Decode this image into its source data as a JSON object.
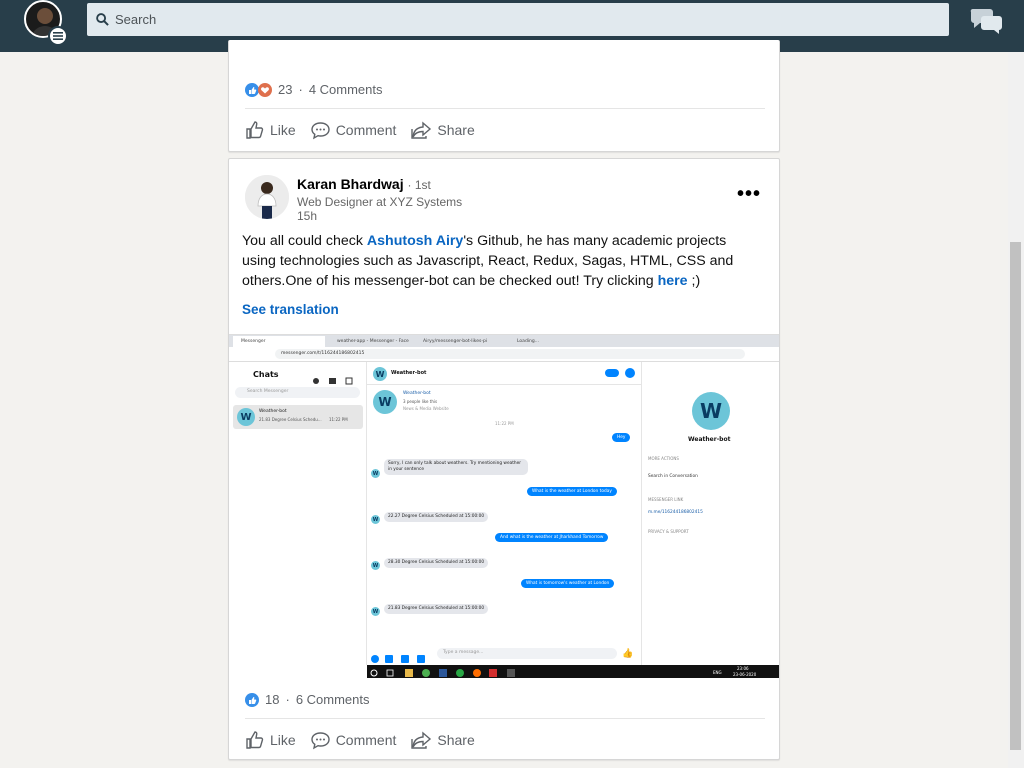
{
  "topbar": {
    "search_placeholder": "Search",
    "colors": {
      "bar": "#283e4a",
      "search_bg": "#e1e9ee"
    },
    "icons": [
      "profile-avatar",
      "menu-icon",
      "search-icon",
      "messaging-icon"
    ]
  },
  "post1": {
    "reactions_count": "23",
    "comments": "4 Comments",
    "reaction_icons": [
      "like-icon",
      "love-icon"
    ],
    "actions": {
      "like": "Like",
      "comment": "Comment",
      "share": "Share"
    }
  },
  "post2": {
    "author": {
      "name": "Karan Bhardwaj",
      "degree": "1st",
      "headline": "Web Designer at XYZ Systems",
      "time": "15h"
    },
    "text": {
      "p1": "You all could check ",
      "link_name": "Ashutosh Airy",
      "p2": "'s Github, he has many academic projects using technologies such as Javascript, React, Redux, Sagas, HTML, CSS and others.One of his messenger-bot can be checked out! Try clicking ",
      "link_here": "here",
      "p3": " ;)"
    },
    "see_translation": "See translation",
    "reactions_count": "18",
    "comments": "6 Comments",
    "actions": {
      "like": "Like",
      "comment": "Comment",
      "share": "Share"
    },
    "link_color": "#0a66c2"
  },
  "screenshot": {
    "tabs": [
      "Messenger",
      "weather-app - Messenger - Face",
      "Airyy/messenger-bot-likes-pi",
      "Loading..."
    ],
    "url": "messenger.com/t/116244186802415",
    "chats_title": "Chats",
    "search_messenger": "Search Messenger",
    "chat_item": {
      "name": "Weather-bot",
      "preview": "21.83 Degree Celsius Schedu...",
      "time": "11:22 PM"
    },
    "header_name": "Weather-bot",
    "intro": {
      "name": "Weather-bot",
      "line1": "3 people like this",
      "line2": "News & Media Website"
    },
    "time_divider": "11:22 PM",
    "messages": [
      {
        "side": "right",
        "text": "Hey"
      },
      {
        "side": "left",
        "text": "Sorry, I can only talk about weathers. Try mentioning weather in your sentence"
      },
      {
        "side": "right",
        "text": "What is the weather at London today"
      },
      {
        "side": "left",
        "text": "22.27 Degree Celsius Scheduled at 15:00:00"
      },
      {
        "side": "right",
        "text": "And what is the weather at Jharkhand Tomorrow"
      },
      {
        "side": "left",
        "text": "28.30 Degree Celsius Scheduled at 15:00:00"
      },
      {
        "side": "right",
        "text": "What is tomorrow's weather at London"
      },
      {
        "side": "left",
        "text": "21.83 Degree Celsius Scheduled at 15:00:00"
      }
    ],
    "composer_placeholder": "Type a message...",
    "right_panel": {
      "name": "Weather-bot",
      "more_actions": "MORE ACTIONS",
      "search_conversation": "Search in Conversation",
      "messenger_link": "MESSENGER LINK",
      "link": "m.me/116244186802415",
      "privacy": "PRIVACY & SUPPORT"
    },
    "taskbar": {
      "lang": "ENG",
      "time": "23:06",
      "date": "23-06-2020"
    },
    "messenger_blue": "#0084ff"
  }
}
